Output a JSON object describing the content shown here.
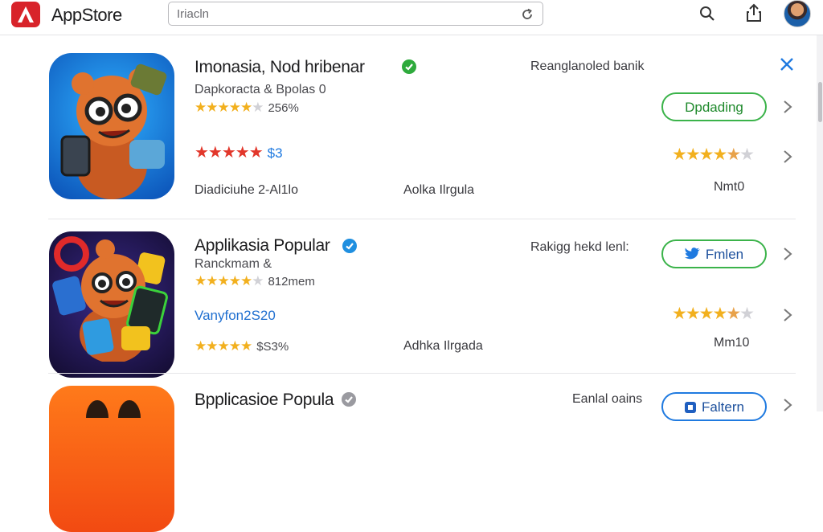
{
  "header": {
    "brand": "AppStore",
    "search_value": "Iriacln",
    "icons": [
      "app-logo-icon",
      "refresh-icon",
      "search-icon",
      "share-icon",
      "profile-avatar"
    ]
  },
  "apps": [
    {
      "title": "Imonasia, Nod hribenar",
      "verified": "green",
      "subtitle": "Dapkoracta & Bpolas 0",
      "rating_text": "256%",
      "price": "$3",
      "rank": "Reanglanoled banik",
      "action": "Dpdading",
      "right_rating": 4.5,
      "meta_left": "Diadiciuhe 2-Al1lo",
      "meta_mid": "Aolka Ilrgula",
      "meta_right": "Nmt0"
    },
    {
      "title": "Applikasia Popular",
      "verified": "blue",
      "subtitle": "Ranckmam &",
      "rating_text": "812mem",
      "price": "Vanyfon2S20",
      "stars_meta": "$S3%",
      "rank": "Rakigg hekd lenl:",
      "action": "Fmlen",
      "right_rating": 4.5,
      "meta_mid": "Adhka Ilrgada",
      "meta_right": "Mm10"
    },
    {
      "title": "Bpplicasioe Popula",
      "verified": "grey",
      "rank": "Eanlal oains",
      "action": "Faltern"
    }
  ],
  "colors": {
    "accent_blue": "#1f7ae0",
    "accent_green": "#3bb34a",
    "star_gold": "#f2b01e",
    "star_red": "#e2372b",
    "logo_red": "#d8232a"
  }
}
